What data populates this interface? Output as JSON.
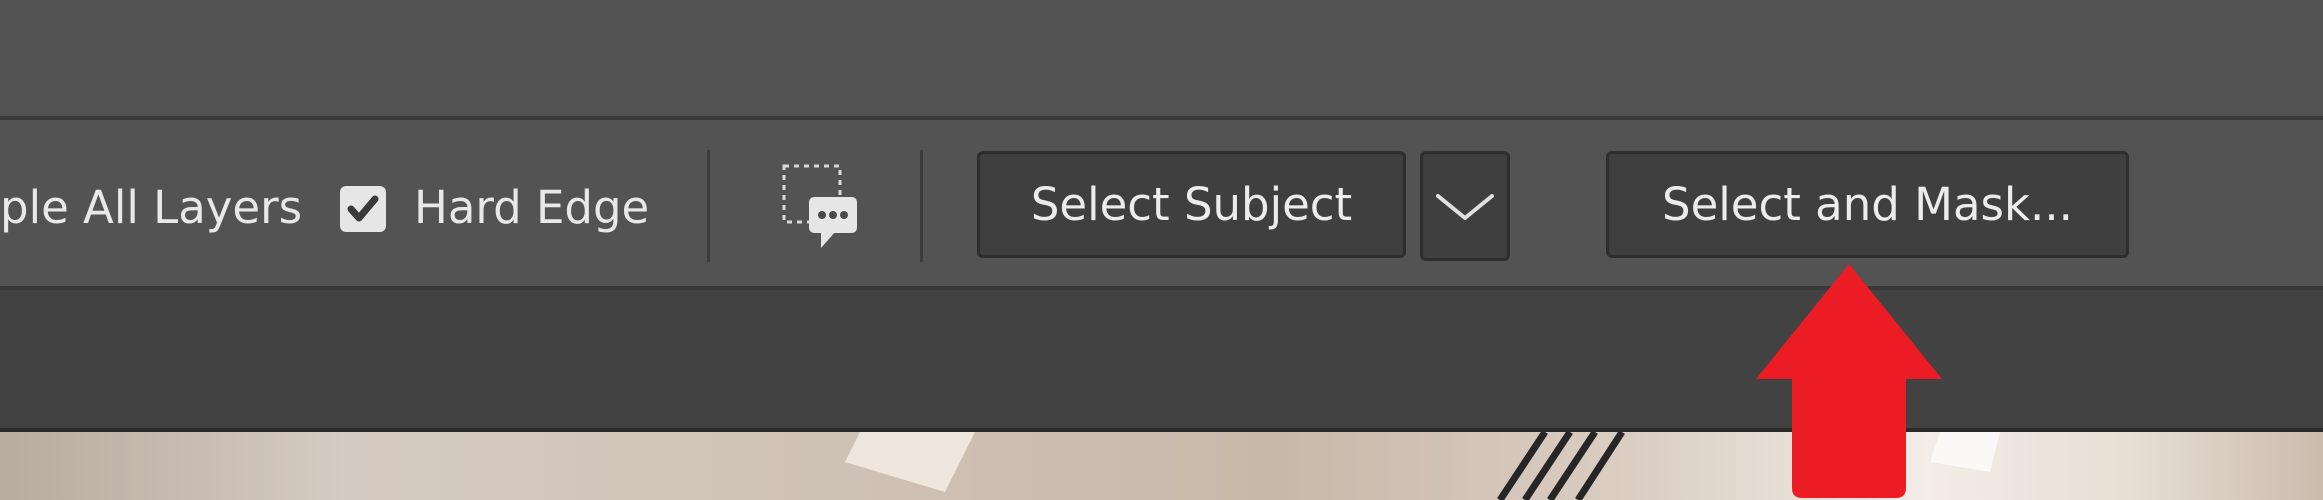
{
  "toolbar": {
    "sample_all_layers_label": "ple All Layers",
    "hard_edge_label": "Hard Edge",
    "hard_edge_checked": true,
    "select_subject_label": "Select Subject",
    "select_and_mask_label": "Select and Mask..."
  },
  "icons": {
    "checkbox": "checkmark-icon",
    "sample": "refine-edge-sample-icon",
    "dropdown": "chevron-down-icon",
    "pointer": "red-arrow-up-icon"
  },
  "colors": {
    "toolbar_bg": "#535353",
    "button_bg": "#3f3f3f",
    "text": "#e8e8e8",
    "arrow": "#ec1c24"
  }
}
